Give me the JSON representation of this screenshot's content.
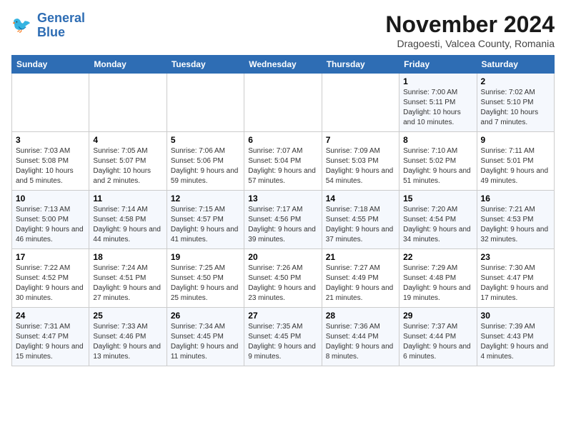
{
  "header": {
    "logo_line1": "General",
    "logo_line2": "Blue",
    "title": "November 2024",
    "subtitle": "Dragoesti, Valcea County, Romania"
  },
  "weekdays": [
    "Sunday",
    "Monday",
    "Tuesday",
    "Wednesday",
    "Thursday",
    "Friday",
    "Saturday"
  ],
  "weeks": [
    [
      {
        "day": "",
        "info": ""
      },
      {
        "day": "",
        "info": ""
      },
      {
        "day": "",
        "info": ""
      },
      {
        "day": "",
        "info": ""
      },
      {
        "day": "",
        "info": ""
      },
      {
        "day": "1",
        "info": "Sunrise: 7:00 AM\nSunset: 5:11 PM\nDaylight: 10 hours and 10 minutes."
      },
      {
        "day": "2",
        "info": "Sunrise: 7:02 AM\nSunset: 5:10 PM\nDaylight: 10 hours and 7 minutes."
      }
    ],
    [
      {
        "day": "3",
        "info": "Sunrise: 7:03 AM\nSunset: 5:08 PM\nDaylight: 10 hours and 5 minutes."
      },
      {
        "day": "4",
        "info": "Sunrise: 7:05 AM\nSunset: 5:07 PM\nDaylight: 10 hours and 2 minutes."
      },
      {
        "day": "5",
        "info": "Sunrise: 7:06 AM\nSunset: 5:06 PM\nDaylight: 9 hours and 59 minutes."
      },
      {
        "day": "6",
        "info": "Sunrise: 7:07 AM\nSunset: 5:04 PM\nDaylight: 9 hours and 57 minutes."
      },
      {
        "day": "7",
        "info": "Sunrise: 7:09 AM\nSunset: 5:03 PM\nDaylight: 9 hours and 54 minutes."
      },
      {
        "day": "8",
        "info": "Sunrise: 7:10 AM\nSunset: 5:02 PM\nDaylight: 9 hours and 51 minutes."
      },
      {
        "day": "9",
        "info": "Sunrise: 7:11 AM\nSunset: 5:01 PM\nDaylight: 9 hours and 49 minutes."
      }
    ],
    [
      {
        "day": "10",
        "info": "Sunrise: 7:13 AM\nSunset: 5:00 PM\nDaylight: 9 hours and 46 minutes."
      },
      {
        "day": "11",
        "info": "Sunrise: 7:14 AM\nSunset: 4:58 PM\nDaylight: 9 hours and 44 minutes."
      },
      {
        "day": "12",
        "info": "Sunrise: 7:15 AM\nSunset: 4:57 PM\nDaylight: 9 hours and 41 minutes."
      },
      {
        "day": "13",
        "info": "Sunrise: 7:17 AM\nSunset: 4:56 PM\nDaylight: 9 hours and 39 minutes."
      },
      {
        "day": "14",
        "info": "Sunrise: 7:18 AM\nSunset: 4:55 PM\nDaylight: 9 hours and 37 minutes."
      },
      {
        "day": "15",
        "info": "Sunrise: 7:20 AM\nSunset: 4:54 PM\nDaylight: 9 hours and 34 minutes."
      },
      {
        "day": "16",
        "info": "Sunrise: 7:21 AM\nSunset: 4:53 PM\nDaylight: 9 hours and 32 minutes."
      }
    ],
    [
      {
        "day": "17",
        "info": "Sunrise: 7:22 AM\nSunset: 4:52 PM\nDaylight: 9 hours and 30 minutes."
      },
      {
        "day": "18",
        "info": "Sunrise: 7:24 AM\nSunset: 4:51 PM\nDaylight: 9 hours and 27 minutes."
      },
      {
        "day": "19",
        "info": "Sunrise: 7:25 AM\nSunset: 4:50 PM\nDaylight: 9 hours and 25 minutes."
      },
      {
        "day": "20",
        "info": "Sunrise: 7:26 AM\nSunset: 4:50 PM\nDaylight: 9 hours and 23 minutes."
      },
      {
        "day": "21",
        "info": "Sunrise: 7:27 AM\nSunset: 4:49 PM\nDaylight: 9 hours and 21 minutes."
      },
      {
        "day": "22",
        "info": "Sunrise: 7:29 AM\nSunset: 4:48 PM\nDaylight: 9 hours and 19 minutes."
      },
      {
        "day": "23",
        "info": "Sunrise: 7:30 AM\nSunset: 4:47 PM\nDaylight: 9 hours and 17 minutes."
      }
    ],
    [
      {
        "day": "24",
        "info": "Sunrise: 7:31 AM\nSunset: 4:47 PM\nDaylight: 9 hours and 15 minutes."
      },
      {
        "day": "25",
        "info": "Sunrise: 7:33 AM\nSunset: 4:46 PM\nDaylight: 9 hours and 13 minutes."
      },
      {
        "day": "26",
        "info": "Sunrise: 7:34 AM\nSunset: 4:45 PM\nDaylight: 9 hours and 11 minutes."
      },
      {
        "day": "27",
        "info": "Sunrise: 7:35 AM\nSunset: 4:45 PM\nDaylight: 9 hours and 9 minutes."
      },
      {
        "day": "28",
        "info": "Sunrise: 7:36 AM\nSunset: 4:44 PM\nDaylight: 9 hours and 8 minutes."
      },
      {
        "day": "29",
        "info": "Sunrise: 7:37 AM\nSunset: 4:44 PM\nDaylight: 9 hours and 6 minutes."
      },
      {
        "day": "30",
        "info": "Sunrise: 7:39 AM\nSunset: 4:43 PM\nDaylight: 9 hours and 4 minutes."
      }
    ]
  ]
}
